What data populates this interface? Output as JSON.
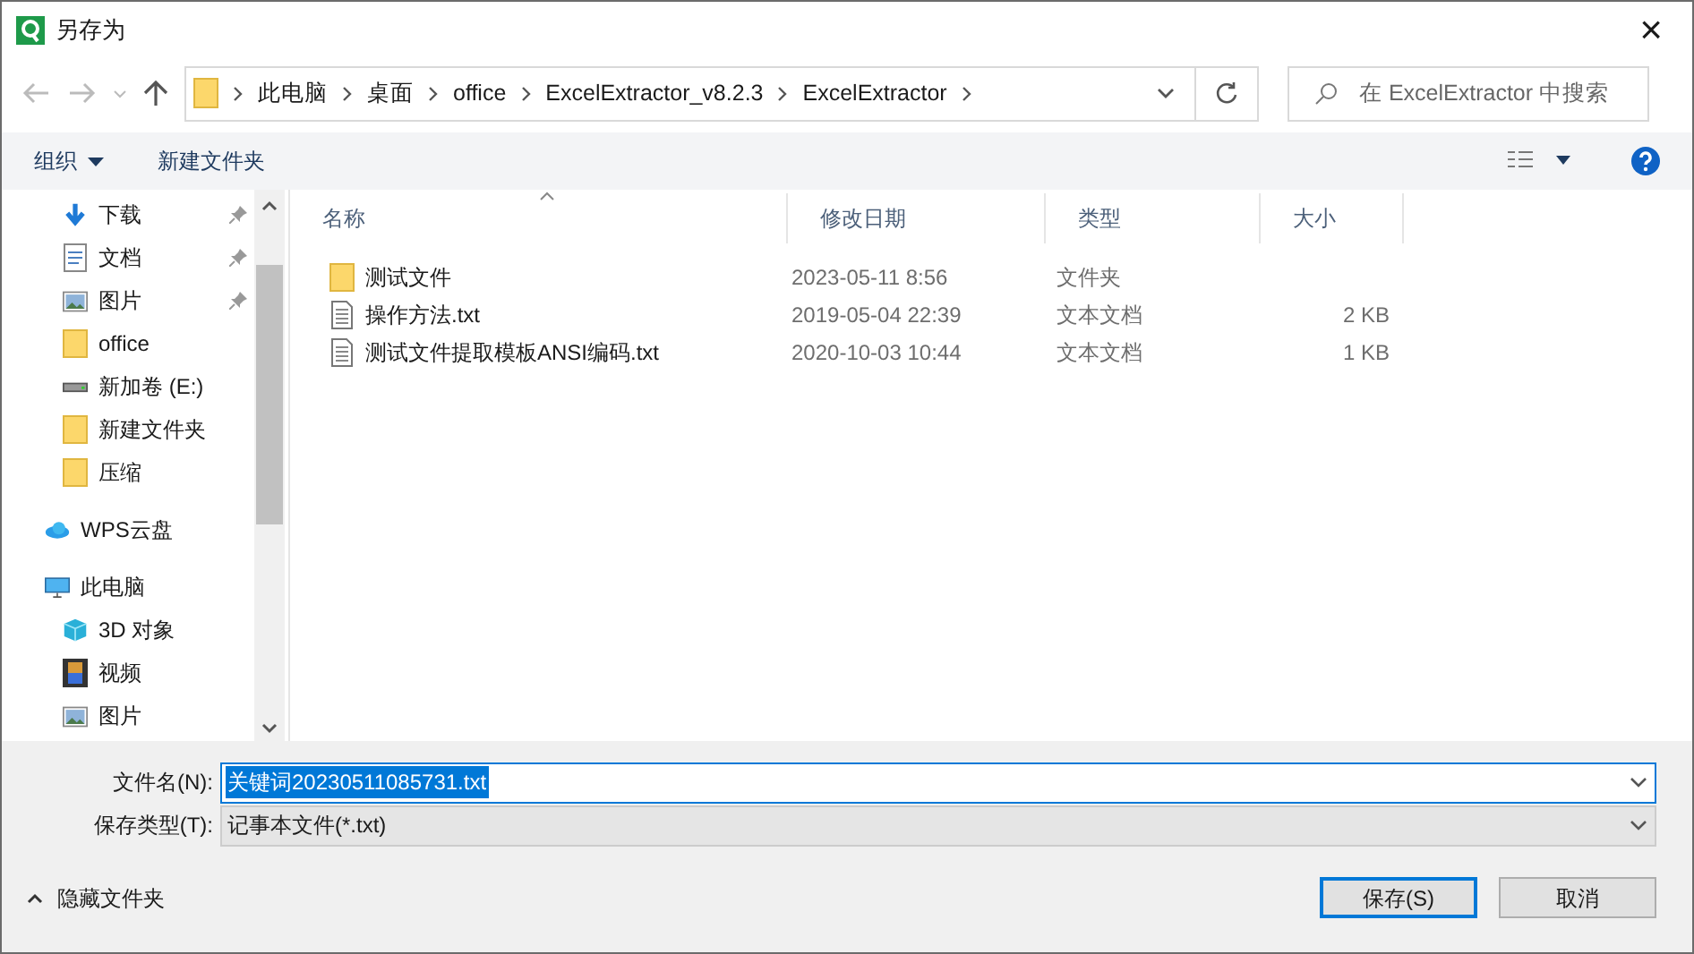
{
  "window": {
    "title": "另存为",
    "close": "×"
  },
  "address": {
    "crumbs": [
      "此电脑",
      "桌面",
      "office",
      "ExcelExtractor_v8.2.3",
      "ExcelExtractor"
    ]
  },
  "search": {
    "placeholder": "在 ExcelExtractor 中搜索"
  },
  "toolbar": {
    "organize": "组织",
    "new_folder": "新建文件夹"
  },
  "nav_tree": [
    {
      "kind": "group",
      "children": [
        {
          "label": "下载",
          "kind": "download",
          "pinned": true
        },
        {
          "label": "文档",
          "kind": "document",
          "pinned": true
        },
        {
          "label": "图片",
          "kind": "picture",
          "pinned": true
        },
        {
          "label": "office",
          "kind": "folder",
          "pinned": false
        },
        {
          "label": "新加卷 (E:)",
          "kind": "drive",
          "pinned": false
        },
        {
          "label": "新建文件夹",
          "kind": "folder",
          "pinned": false
        },
        {
          "label": "压缩",
          "kind": "folder",
          "pinned": false
        }
      ]
    },
    {
      "label": "WPS云盘",
      "kind": "cloud",
      "pinned": false
    },
    {
      "label": "此电脑",
      "kind": "pc",
      "pinned": false,
      "children": [
        {
          "label": "3D 对象",
          "kind": "cube",
          "pinned": false
        },
        {
          "label": "视频",
          "kind": "video",
          "pinned": false
        },
        {
          "label": "图片",
          "kind": "picture",
          "pinned": false
        }
      ]
    }
  ],
  "table": {
    "columns": [
      {
        "label": "名称",
        "sorted": true
      },
      {
        "label": "修改日期",
        "sorted": false
      },
      {
        "label": "类型",
        "sorted": false
      },
      {
        "label": "大小",
        "sorted": false
      }
    ],
    "rows": [
      {
        "kind": "folder",
        "name": "测试文件",
        "date": "2023-05-11 8:56",
        "type": "文件夹"
      },
      {
        "kind": "text",
        "name": "操作方法.txt",
        "date": "2019-05-04 22:39",
        "type": "文本文档",
        "size": "2 KB"
      },
      {
        "kind": "text",
        "name": "测试文件提取模板ANSI编码.txt",
        "date": "2020-10-03 10:44",
        "type": "文本文档",
        "size": "1 KB"
      }
    ]
  },
  "file_name": {
    "label": "文件名(N):",
    "value": "关键词20230511085731.txt",
    "selected": true
  },
  "save_type": {
    "label": "保存类型(T):",
    "value": "记事本文件(*.txt)"
  },
  "hide_folders": "隐藏文件夹",
  "buttons": [
    {
      "label": "保存(S)",
      "default": true
    },
    {
      "label": "取消",
      "default": false
    }
  ]
}
